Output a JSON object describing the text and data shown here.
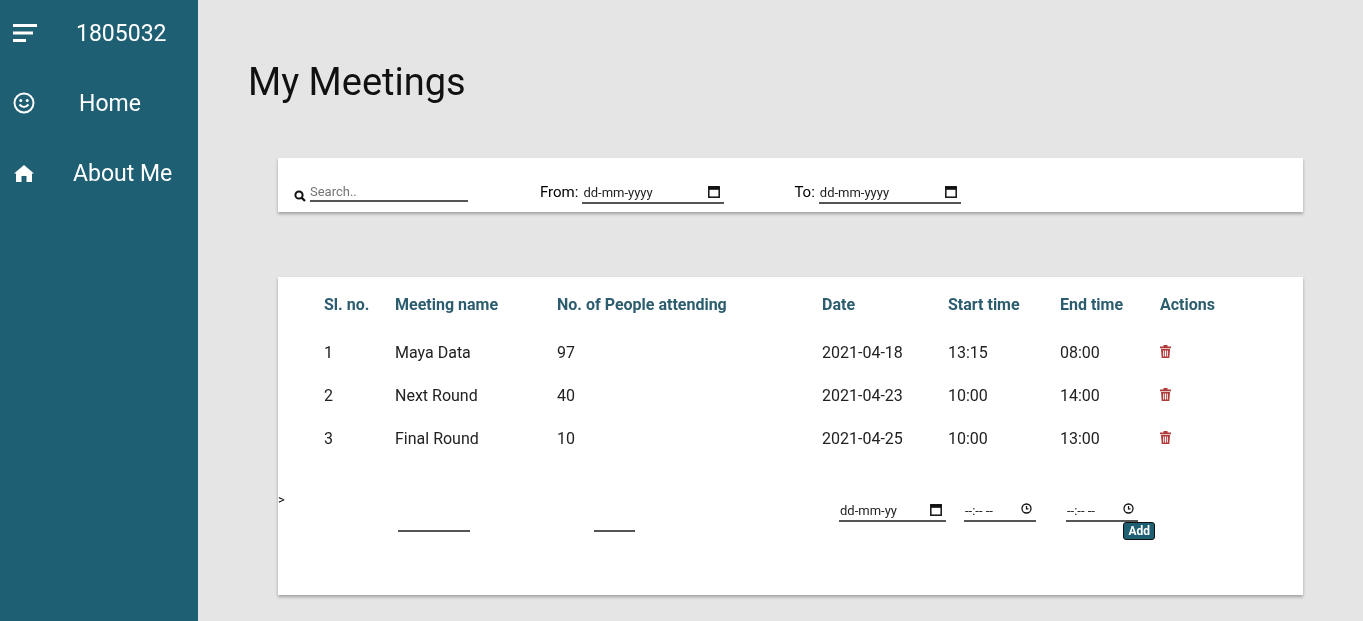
{
  "sidebar": {
    "user_id": "1805032",
    "items": [
      {
        "label": "Home",
        "kind": "smiley"
      },
      {
        "label": "About Me",
        "kind": "house"
      }
    ]
  },
  "page_title": "My Meetings",
  "filters": {
    "search": {
      "placeholder": "Search.."
    },
    "from": {
      "label": "From:",
      "placeholder": "dd-mm-yyyy"
    },
    "to": {
      "label": "To:",
      "placeholder": "dd-mm-yyyy"
    }
  },
  "table": {
    "columns": [
      "Sl. no.",
      "Meeting name",
      "No. of People attending",
      "Date",
      "Start time",
      "End time",
      "Actions"
    ],
    "rows": [
      [
        "1",
        "Maya Data",
        "97",
        "2021-04-18",
        "13:15",
        "08:00"
      ],
      [
        "2",
        "Next Round",
        "40",
        "2021-04-23",
        "10:00",
        "14:00"
      ],
      [
        "3",
        "Final Round",
        "10",
        "2021-04-25",
        "10:00",
        "13:00"
      ]
    ]
  },
  "stray_text": ">",
  "add_row": {
    "date_placeholder": "dd-mm-yy",
    "start_placeholder": "--:-- --",
    "end_placeholder": "--:-- --",
    "button": "Add"
  }
}
